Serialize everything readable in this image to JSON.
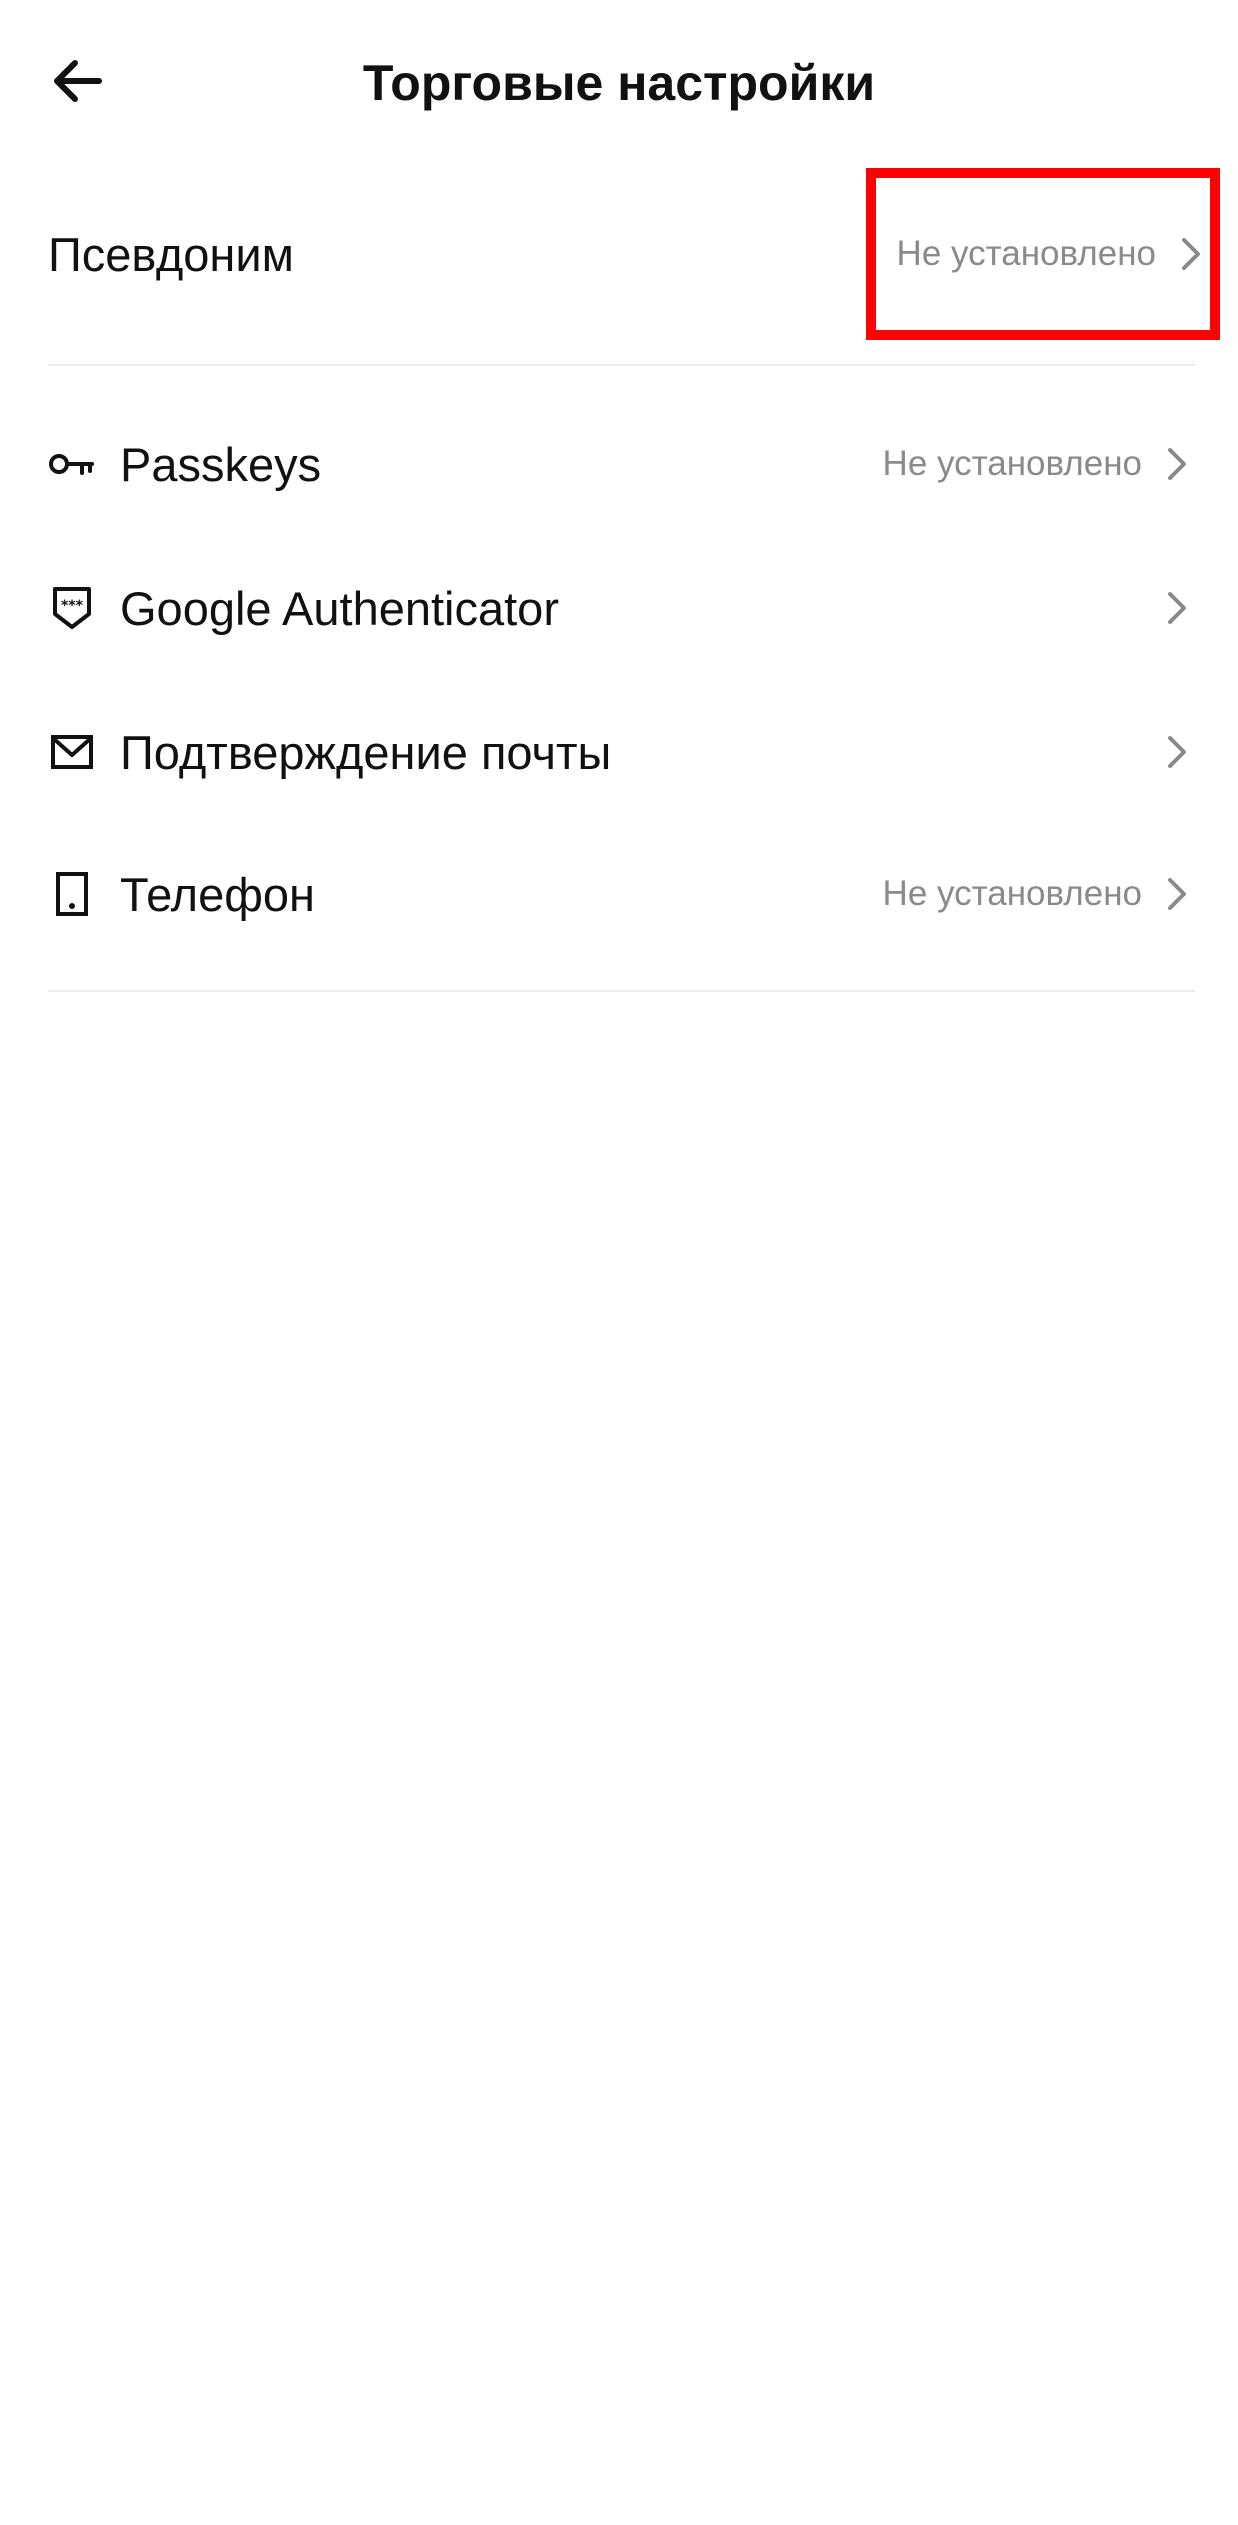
{
  "header": {
    "title": "Торговые настройки",
    "back_icon": "arrow-left-icon"
  },
  "nickname": {
    "label": "Псевдоним",
    "value": "Не установлено"
  },
  "security_items": [
    {
      "label": "Passkeys",
      "value": "Не установлено",
      "icon": "key-icon"
    },
    {
      "label": "Google Authenticator",
      "value": "",
      "icon": "shield-icon"
    },
    {
      "label": "Подтверждение почты",
      "value": "",
      "icon": "mail-icon"
    },
    {
      "label": "Телефон",
      "value": "Не установлено",
      "icon": "phone-icon"
    }
  ],
  "colors": {
    "text": "#111111",
    "muted": "#8a8a8a",
    "divider": "#ececec",
    "highlight": "#ff0000"
  }
}
